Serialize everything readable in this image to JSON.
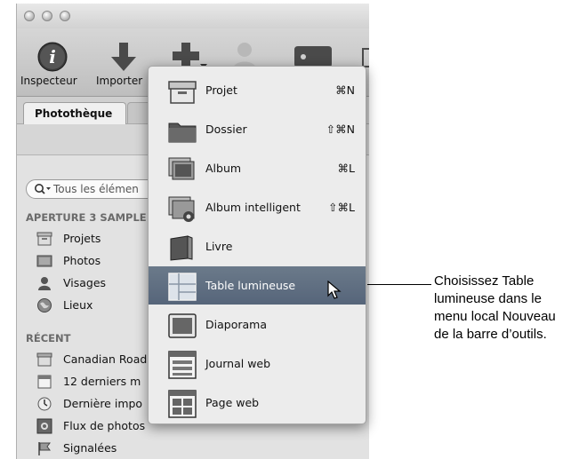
{
  "toolbar": {
    "inspector_label": "Inspecteur",
    "import_label": "Importer"
  },
  "tabs": {
    "library_label": "Photothèque"
  },
  "search": {
    "placeholder": "Tous les élémen"
  },
  "sidebar": {
    "section1_title": "APERTURE 3 SAMPLE",
    "library_items": [
      {
        "label": "Projets",
        "icon": "projects-icon"
      },
      {
        "label": "Photos",
        "icon": "photos-icon"
      },
      {
        "label": "Visages",
        "icon": "faces-icon"
      },
      {
        "label": "Lieux",
        "icon": "places-icon"
      }
    ],
    "section2_title": "RÉCENT",
    "recent_items": [
      {
        "label": "Canadian Road",
        "icon": "project-box-icon"
      },
      {
        "label": "12 derniers m",
        "icon": "calendar-icon"
      },
      {
        "label": "Dernière impo",
        "icon": "import-clock-icon"
      },
      {
        "label": "Flux de photos",
        "icon": "photostream-icon"
      },
      {
        "label": "Signalées",
        "icon": "flag-icon"
      }
    ]
  },
  "new_menu": {
    "items": [
      {
        "label": "Projet",
        "shortcut": "⌘N",
        "icon": "project-icon"
      },
      {
        "label": "Dossier",
        "shortcut": "⇧⌘N",
        "icon": "folder-icon"
      },
      {
        "label": "Album",
        "shortcut": "⌘L",
        "icon": "album-icon"
      },
      {
        "label": "Album intelligent",
        "shortcut": "⇧⌘L",
        "icon": "smart-album-icon"
      },
      {
        "label": "Livre",
        "shortcut": "",
        "icon": "book-icon"
      },
      {
        "label": "Table lumineuse",
        "shortcut": "",
        "icon": "light-table-icon",
        "selected": true
      },
      {
        "label": "Diaporama",
        "shortcut": "",
        "icon": "slideshow-icon"
      },
      {
        "label": "Journal web",
        "shortcut": "",
        "icon": "web-journal-icon"
      },
      {
        "label": "Page web",
        "shortcut": "",
        "icon": "web-page-icon"
      }
    ]
  },
  "callout": {
    "lines": [
      "Choisissez Table",
      "lumineuse dans le",
      "menu local Nouveau",
      "de la barre d’outils."
    ]
  },
  "colors": {
    "selected_row": "#5d6c80",
    "menu_bg": "#ececec",
    "sidebar_bg": "#e2e2e2"
  }
}
